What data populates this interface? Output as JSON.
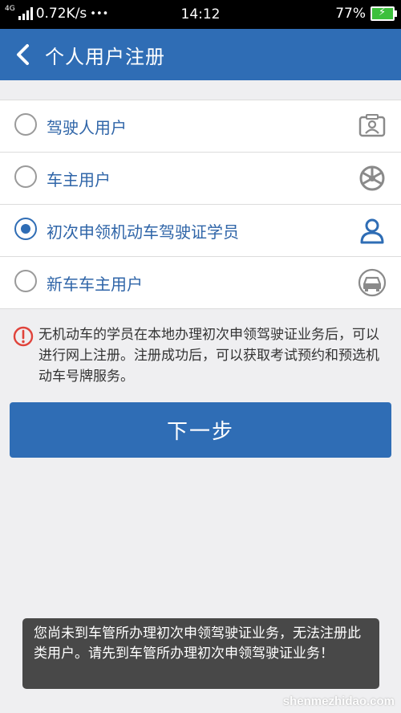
{
  "status_bar": {
    "network": "4G",
    "speed": "0.72K/s",
    "more": "•••",
    "time": "14:12",
    "battery": "77%"
  },
  "header": {
    "title": "个人用户注册",
    "back_icon": "chevron-left-icon"
  },
  "options": [
    {
      "label": "驾驶人用户",
      "selected": false,
      "icon": "id-card-icon"
    },
    {
      "label": "车主用户",
      "selected": false,
      "icon": "steering-wheel-icon"
    },
    {
      "label": "初次申领机动车驾驶证学员",
      "selected": true,
      "icon": "person-icon"
    },
    {
      "label": "新车车主用户",
      "selected": false,
      "icon": "car-icon"
    }
  ],
  "notice": {
    "icon": "info-icon",
    "text": "无机动车的学员在本地办理初次申领驾驶证业务后，可以进行网上注册。注册成功后，可以获取考试预约和预选机动车号牌服务。"
  },
  "next_button": {
    "label": "下一步"
  },
  "toast": {
    "text": "您尚未到车管所办理初次申领驾驶证业务，无法注册此类用户。请先到车管所办理初次申领驾驶证业务！"
  },
  "watermark": "shenmezhidao.com",
  "colors": {
    "primary": "#2f6db5",
    "background": "#efeff1",
    "alert": "#e0433b"
  }
}
